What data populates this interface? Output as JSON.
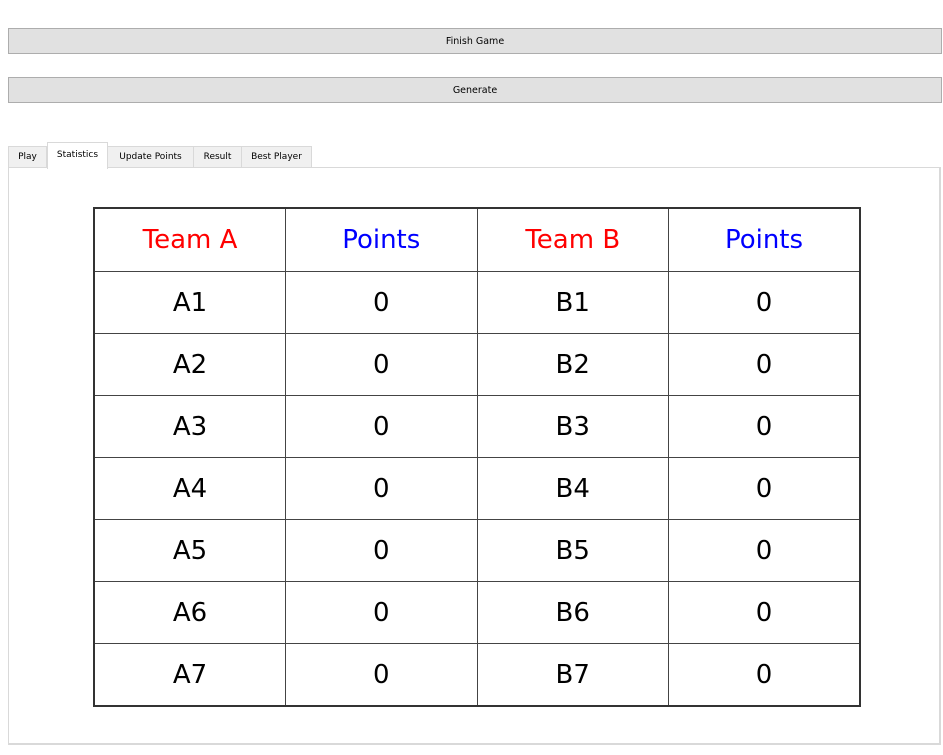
{
  "buttons": {
    "finish_game": "Finish Game",
    "generate": "Generate"
  },
  "tabs": [
    {
      "label": "Play",
      "selected": false
    },
    {
      "label": "Statistics",
      "selected": true
    },
    {
      "label": "Update Points",
      "selected": false
    },
    {
      "label": "Result",
      "selected": false
    },
    {
      "label": "Best Player",
      "selected": false
    }
  ],
  "statistics": {
    "headers": {
      "team_a": "Team A",
      "points_a": "Points",
      "team_b": "Team B",
      "points_b": "Points"
    },
    "header_colors": {
      "team": "#ff0000",
      "points": "#0000ff"
    },
    "rows": [
      {
        "team_a": "A1",
        "points_a": "0",
        "team_b": "B1",
        "points_b": "0"
      },
      {
        "team_a": "A2",
        "points_a": "0",
        "team_b": "B2",
        "points_b": "0"
      },
      {
        "team_a": "A3",
        "points_a": "0",
        "team_b": "B3",
        "points_b": "0"
      },
      {
        "team_a": "A4",
        "points_a": "0",
        "team_b": "B4",
        "points_b": "0"
      },
      {
        "team_a": "A5",
        "points_a": "0",
        "team_b": "B5",
        "points_b": "0"
      },
      {
        "team_a": "A6",
        "points_a": "0",
        "team_b": "B6",
        "points_b": "0"
      },
      {
        "team_a": "A7",
        "points_a": "0",
        "team_b": "B7",
        "points_b": "0"
      }
    ]
  }
}
